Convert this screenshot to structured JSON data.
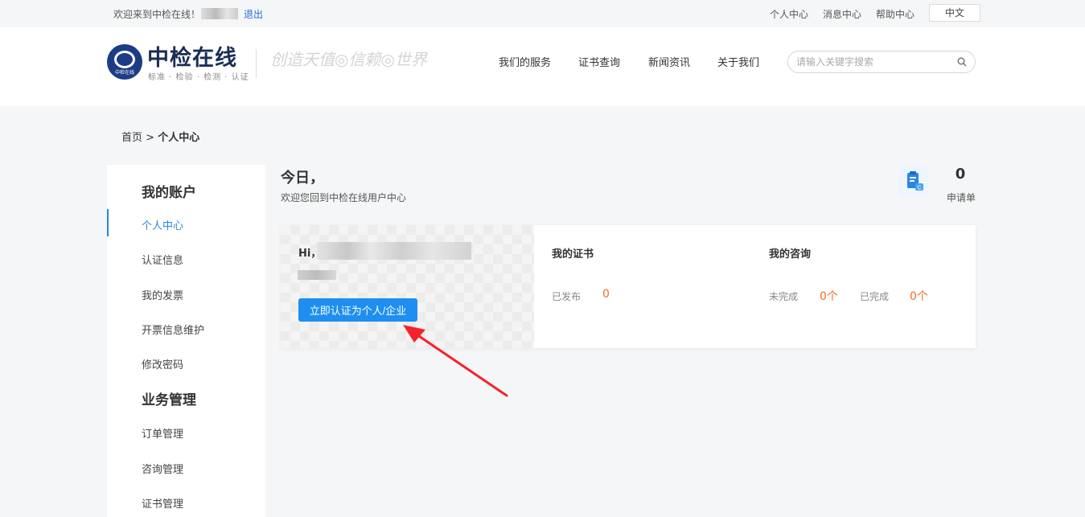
{
  "topbar": {
    "welcome": "欢迎来到中检在线！",
    "logout": "退出",
    "links": [
      "个人中心",
      "消息中心",
      "帮助中心"
    ],
    "language": "中文"
  },
  "header": {
    "logo_name": "中检在线",
    "logo_sub": "标准 · 检验 · 检测 · 认证",
    "logo_mark_text": "中检在线",
    "slogan": "创造天值◎信赖◎世界",
    "nav": [
      "我们的服务",
      "证书查询",
      "新闻资讯",
      "关于我们"
    ],
    "search_placeholder": "请输入关键字搜索"
  },
  "breadcrumb": {
    "home": "首页",
    "separator": ">",
    "current": "个人中心"
  },
  "sidebar": {
    "groups": [
      {
        "title": "我的账户",
        "items": [
          "个人中心",
          "认证信息",
          "我的发票",
          "开票信息维护",
          "修改密码"
        ]
      },
      {
        "title": "业务管理",
        "items": [
          "订单管理",
          "咨询管理",
          "证书管理"
        ]
      }
    ],
    "active": "个人中心"
  },
  "main": {
    "greeting": "今日，",
    "subtitle": "欢迎您回到中检在线用户中心",
    "application": {
      "count": "0",
      "label": "申请单",
      "icon": "clipboard-icon"
    },
    "card": {
      "hi": "Hi，",
      "verify_button": "立即认证为个人/企业",
      "certificates": {
        "title": "我的证书",
        "published_label": "已发布",
        "published_value": "0"
      },
      "consult": {
        "title": "我的咨询",
        "unfinished_label": "未完成",
        "unfinished_value": "0个",
        "finished_label": "已完成",
        "finished_value": "0个"
      }
    }
  },
  "colors": {
    "accent": "#2b85e4",
    "button": "#1e8ff0",
    "highlight": "#f26b2a",
    "annotation_arrow": "#f5222d"
  }
}
